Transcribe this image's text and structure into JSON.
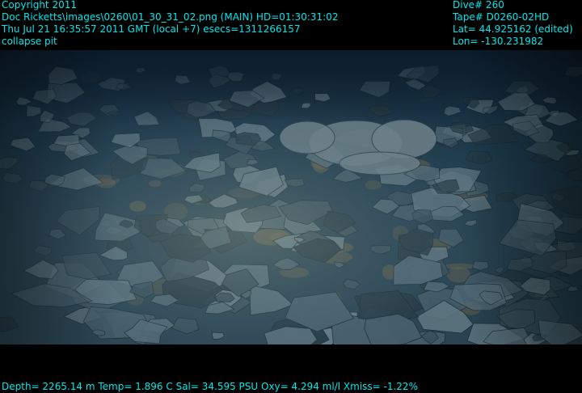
{
  "overlay": {
    "top_left": {
      "line1": "Copyright 2011",
      "line2": "Doc Ricketts\\images\\0260\\01_30_31_02.png (MAIN)  HD=01:30:31:02",
      "line3": "Thu Jul 21 16:35:57 2011 GMT (local +7)  esecs=1311266157",
      "line4": "collapse pit"
    },
    "top_right": {
      "line1": "Dive# 260",
      "line2": "Tape# D0260-02HD",
      "line3": "Lat= 44.925162 (edited)",
      "line4": "Lon= -130.231982"
    },
    "bottom": {
      "line1": "Depth= 2265.14 m  Temp= 1.896 C  Sal= 34.595 PSU  Oxy= 4.294 ml/l  Xmiss= -1.22%"
    },
    "text_color": "#00e6ea"
  },
  "scene": {
    "subject": "seafloor-rubble",
    "palette": {
      "water_dark": "#0f2436",
      "water_mid": "#1d3a4d",
      "rock_light": "#6f8790",
      "rock_mid": "#4a6470",
      "rock_dark": "#22363f",
      "sediment": "#7a6a48"
    }
  }
}
